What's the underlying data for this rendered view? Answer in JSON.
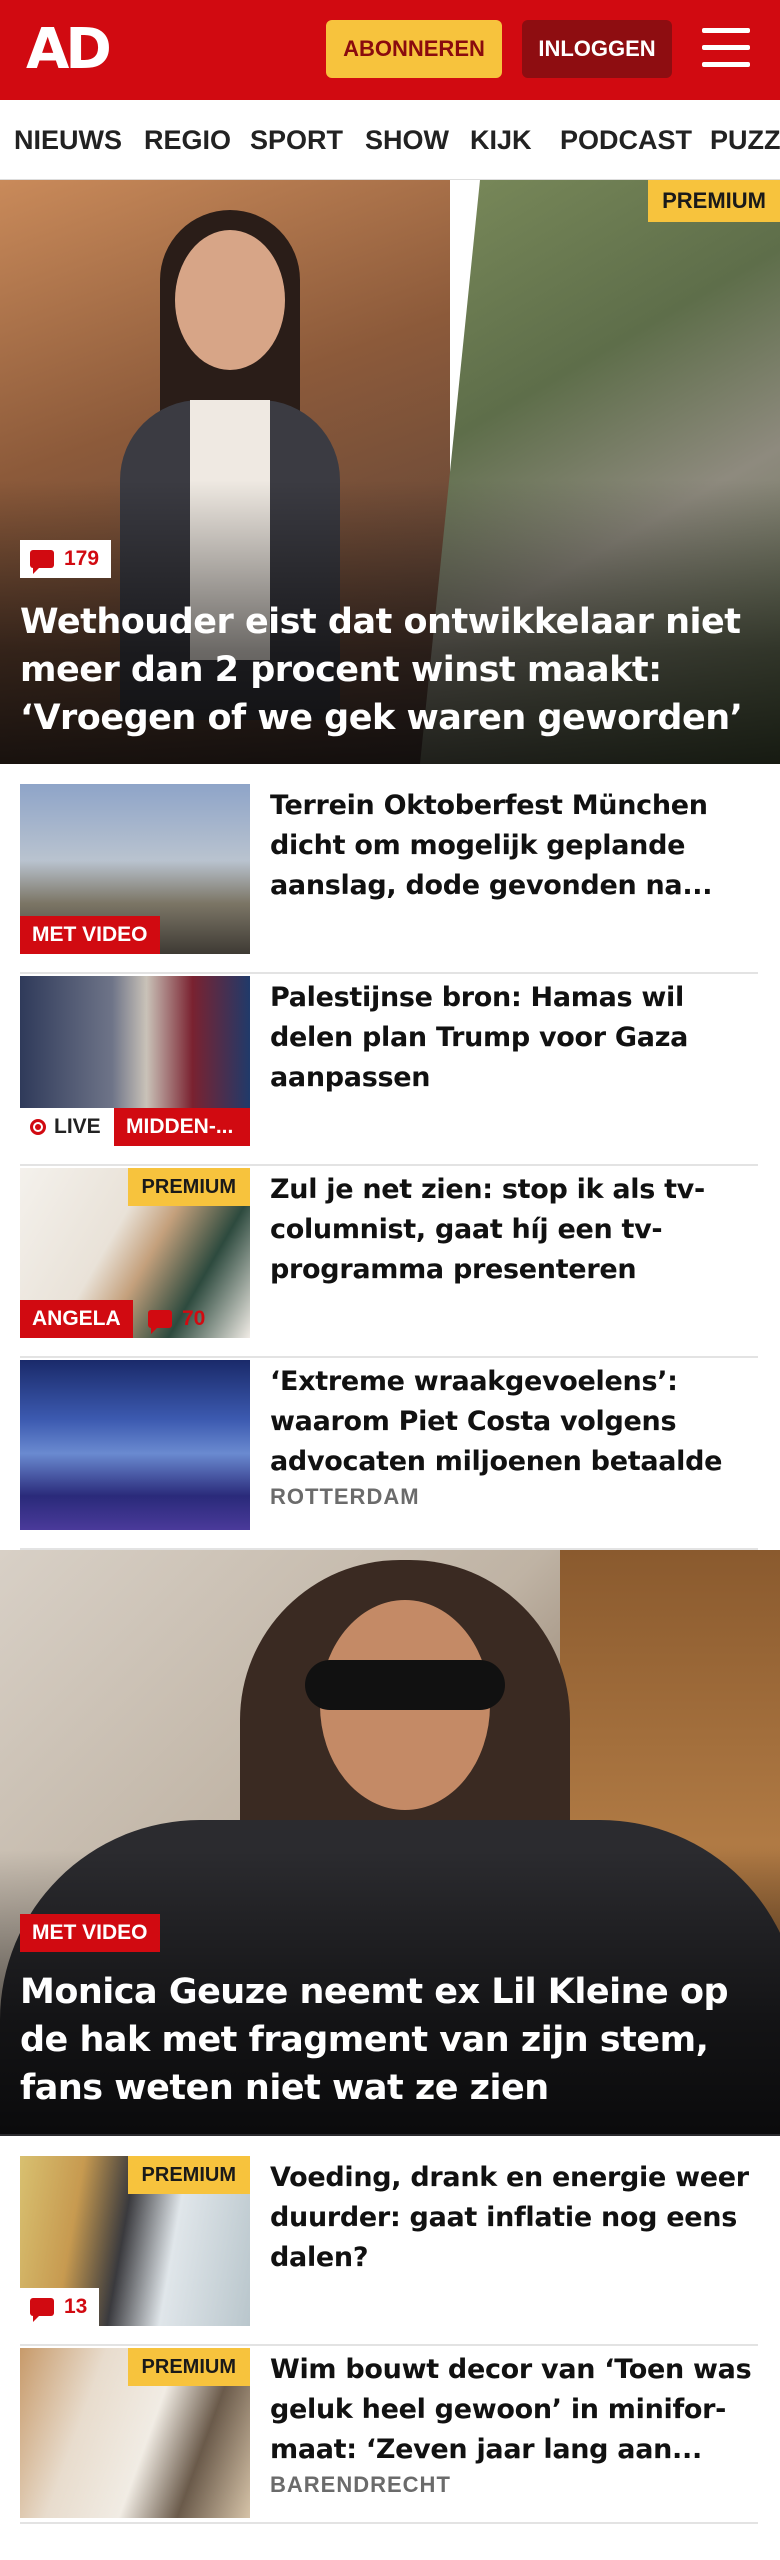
{
  "header": {
    "logo": "AD",
    "subscribe_label": "ABONNEREN",
    "login_label": "INLOGGEN",
    "colors": {
      "brand_red": "#d10a11",
      "subscribe_yellow": "#f7c33d"
    }
  },
  "nav": {
    "items": [
      "NIEUWS",
      "REGIO",
      "SPORT",
      "SHOW",
      "KIJK",
      "PODCAST",
      "PUZZ"
    ]
  },
  "hero": {
    "premium_label": "PREMIUM",
    "comment_count": "179",
    "title": "Wethouder eist dat ontwikkelaar niet meer dan 2 procent winst maakt: ‘Vroegen of we gek waren geworden’"
  },
  "articles": [
    {
      "title": "Terrein Oktoberfest München dicht om mogelijk geplande aanslag, dode gevonden na...",
      "tag": "MET VIDEO"
    },
    {
      "title": "Palestijnse bron: Hamas wil delen plan Trump voor Gaza aanpassen",
      "live_label": "LIVE",
      "tag": "MIDDEN-..."
    },
    {
      "title": "Zul je net zien: stop ik als tv-columnist, gaat híj een tv-programma presenteren",
      "premium_label": "PREMIUM",
      "tag": "ANGELA",
      "comment_count": "70"
    },
    {
      "title": "‘Extreme wraakgevoelens’: waarom Piet Costa volgens advocaten miljoenen betaalde",
      "location": "ROTTERDAM"
    }
  ],
  "hero2": {
    "tag": "MET VIDEO",
    "title": "Monica Geuze neemt ex Lil Kleine op de hak met fragment van zijn stem, fans weten niet wat ze zien"
  },
  "articles2": [
    {
      "title": "Voeding, drank en energie weer duurder: gaat inflatie nog eens dalen?",
      "premium_label": "PREMIUM",
      "comment_count": "13"
    },
    {
      "title": "Wim bouwt decor van ‘Toen was geluk heel gewoon’ in minifor-maat: ‘Zeven jaar lang aan...",
      "premium_label": "PREMIUM",
      "location": "BARENDRECHT"
    }
  ]
}
